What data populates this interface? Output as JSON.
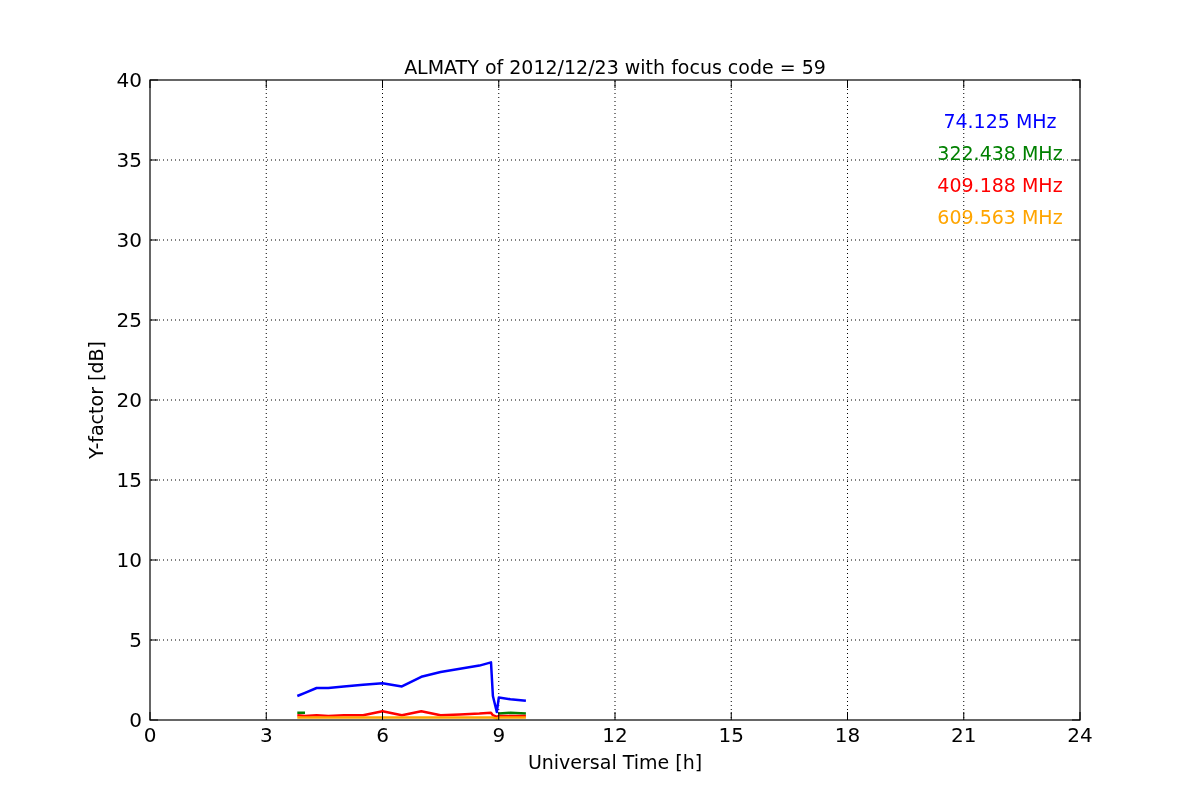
{
  "chart_data": {
    "type": "line",
    "title": "ALMATY of 2012/12/23 with focus code = 59",
    "xlabel": "Universal Time [h]",
    "ylabel": "Y-factor [dB]",
    "x": [
      3.8,
      4.0,
      4.3,
      4.6,
      5.0,
      5.5,
      6.0,
      6.5,
      7.0,
      7.5,
      8.0,
      8.5,
      8.8,
      8.85,
      8.95,
      9.0,
      9.3,
      9.7
    ],
    "series": [
      {
        "name": "74.125 MHz",
        "color": "#0000ff",
        "values": [
          1.5,
          1.7,
          2.0,
          2.0,
          2.1,
          2.2,
          2.3,
          2.1,
          2.7,
          3.0,
          3.2,
          3.4,
          3.6,
          1.5,
          0.5,
          1.4,
          1.3,
          1.2
        ]
      },
      {
        "name": "322.438 MHz",
        "color": "#008000",
        "values": [
          0.45,
          0.45,
          null,
          null,
          null,
          null,
          null,
          null,
          null,
          null,
          null,
          null,
          null,
          null,
          null,
          0.4,
          0.45,
          0.4
        ]
      },
      {
        "name": "409.188 MHz",
        "color": "#ff0000",
        "values": [
          0.3,
          0.25,
          0.3,
          0.25,
          0.3,
          0.3,
          0.55,
          0.3,
          0.55,
          0.3,
          0.35,
          0.4,
          0.45,
          0.3,
          0.2,
          0.25,
          0.25,
          0.25
        ]
      },
      {
        "name": "609.563 MHz",
        "color": "#ffa500",
        "values": [
          0.15,
          0.15,
          0.15,
          0.15,
          0.15,
          0.15,
          0.15,
          0.15,
          0.15,
          0.15,
          0.15,
          0.15,
          0.15,
          0.15,
          0.1,
          0.15,
          0.15,
          0.15
        ]
      }
    ],
    "grid": true,
    "xlim": [
      0,
      24
    ],
    "ylim": [
      0,
      40
    ],
    "xticks": [
      0,
      3,
      6,
      9,
      12,
      15,
      18,
      21,
      24
    ],
    "yticks": [
      0,
      5,
      10,
      15,
      20,
      25,
      30,
      35,
      40
    ]
  }
}
